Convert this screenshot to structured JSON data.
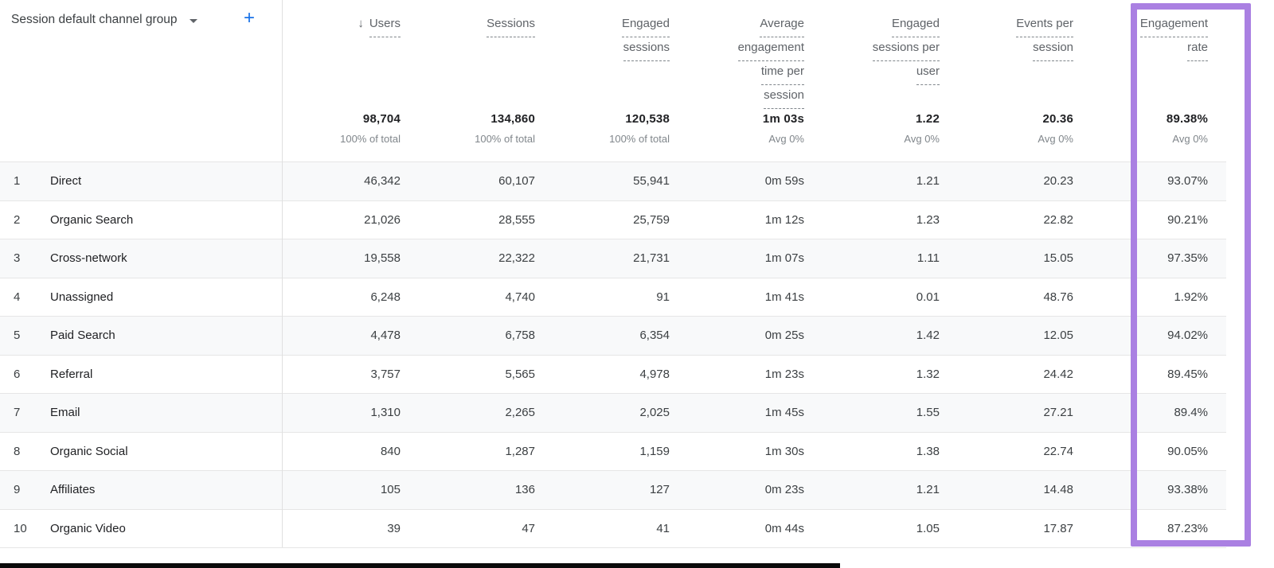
{
  "colors": {
    "highlight_purple": "#aa80e2",
    "add_button_blue": "#1a73e8",
    "row_stripe": "#f8f9fa",
    "row_border": "#e6e6e6",
    "header_text": "#5f6368",
    "body_text": "#3c4043"
  },
  "icons": {
    "sort_descending": "↓",
    "caret_down": "caret-down",
    "add": "+"
  },
  "dimension": {
    "label": "Session default channel group"
  },
  "columns": [
    {
      "id": "users",
      "header_lines": [
        "Users"
      ],
      "sorted": true,
      "total": "98,704",
      "total_sub": "100% of total"
    },
    {
      "id": "sessions",
      "header_lines": [
        "Sessions"
      ],
      "sorted": false,
      "total": "134,860",
      "total_sub": "100% of total"
    },
    {
      "id": "engaged-sessions",
      "header_lines": [
        "Engaged",
        "sessions"
      ],
      "sorted": false,
      "total": "120,538",
      "total_sub": "100% of total"
    },
    {
      "id": "avg-engagement-time-per-session",
      "header_lines": [
        "Average",
        "engagement",
        "time per",
        "session"
      ],
      "sorted": false,
      "total": "1m 03s",
      "total_sub": "Avg 0%"
    },
    {
      "id": "engaged-sessions-per-user",
      "header_lines": [
        "Engaged",
        "sessions per",
        "user"
      ],
      "sorted": false,
      "total": "1.22",
      "total_sub": "Avg 0%"
    },
    {
      "id": "events-per-session",
      "header_lines": [
        "Events per",
        "session"
      ],
      "sorted": false,
      "total": "20.36",
      "total_sub": "Avg 0%"
    },
    {
      "id": "engagement-rate",
      "header_lines": [
        "Engagement",
        "rate"
      ],
      "sorted": false,
      "total": "89.38%",
      "total_sub": "Avg 0%",
      "highlighted": true
    }
  ],
  "rows": [
    {
      "rank": "1",
      "channel": "Direct",
      "values": [
        "46,342",
        "60,107",
        "55,941",
        "0m 59s",
        "1.21",
        "20.23",
        "93.07%"
      ]
    },
    {
      "rank": "2",
      "channel": "Organic Search",
      "values": [
        "21,026",
        "28,555",
        "25,759",
        "1m 12s",
        "1.23",
        "22.82",
        "90.21%"
      ]
    },
    {
      "rank": "3",
      "channel": "Cross-network",
      "values": [
        "19,558",
        "22,322",
        "21,731",
        "1m 07s",
        "1.11",
        "15.05",
        "97.35%"
      ]
    },
    {
      "rank": "4",
      "channel": "Unassigned",
      "values": [
        "6,248",
        "4,740",
        "91",
        "1m 41s",
        "0.01",
        "48.76",
        "1.92%"
      ]
    },
    {
      "rank": "5",
      "channel": "Paid Search",
      "values": [
        "4,478",
        "6,758",
        "6,354",
        "0m 25s",
        "1.42",
        "12.05",
        "94.02%"
      ]
    },
    {
      "rank": "6",
      "channel": "Referral",
      "values": [
        "3,757",
        "5,565",
        "4,978",
        "1m 23s",
        "1.32",
        "24.42",
        "89.45%"
      ]
    },
    {
      "rank": "7",
      "channel": "Email",
      "values": [
        "1,310",
        "2,265",
        "2,025",
        "1m 45s",
        "1.55",
        "27.21",
        "89.4%"
      ]
    },
    {
      "rank": "8",
      "channel": "Organic Social",
      "values": [
        "840",
        "1,287",
        "1,159",
        "1m 30s",
        "1.38",
        "22.74",
        "90.05%"
      ]
    },
    {
      "rank": "9",
      "channel": "Affiliates",
      "values": [
        "105",
        "136",
        "127",
        "0m 23s",
        "1.21",
        "14.48",
        "93.38%"
      ]
    },
    {
      "rank": "10",
      "channel": "Organic Video",
      "values": [
        "39",
        "47",
        "41",
        "0m 44s",
        "1.05",
        "17.87",
        "87.23%"
      ]
    }
  ]
}
